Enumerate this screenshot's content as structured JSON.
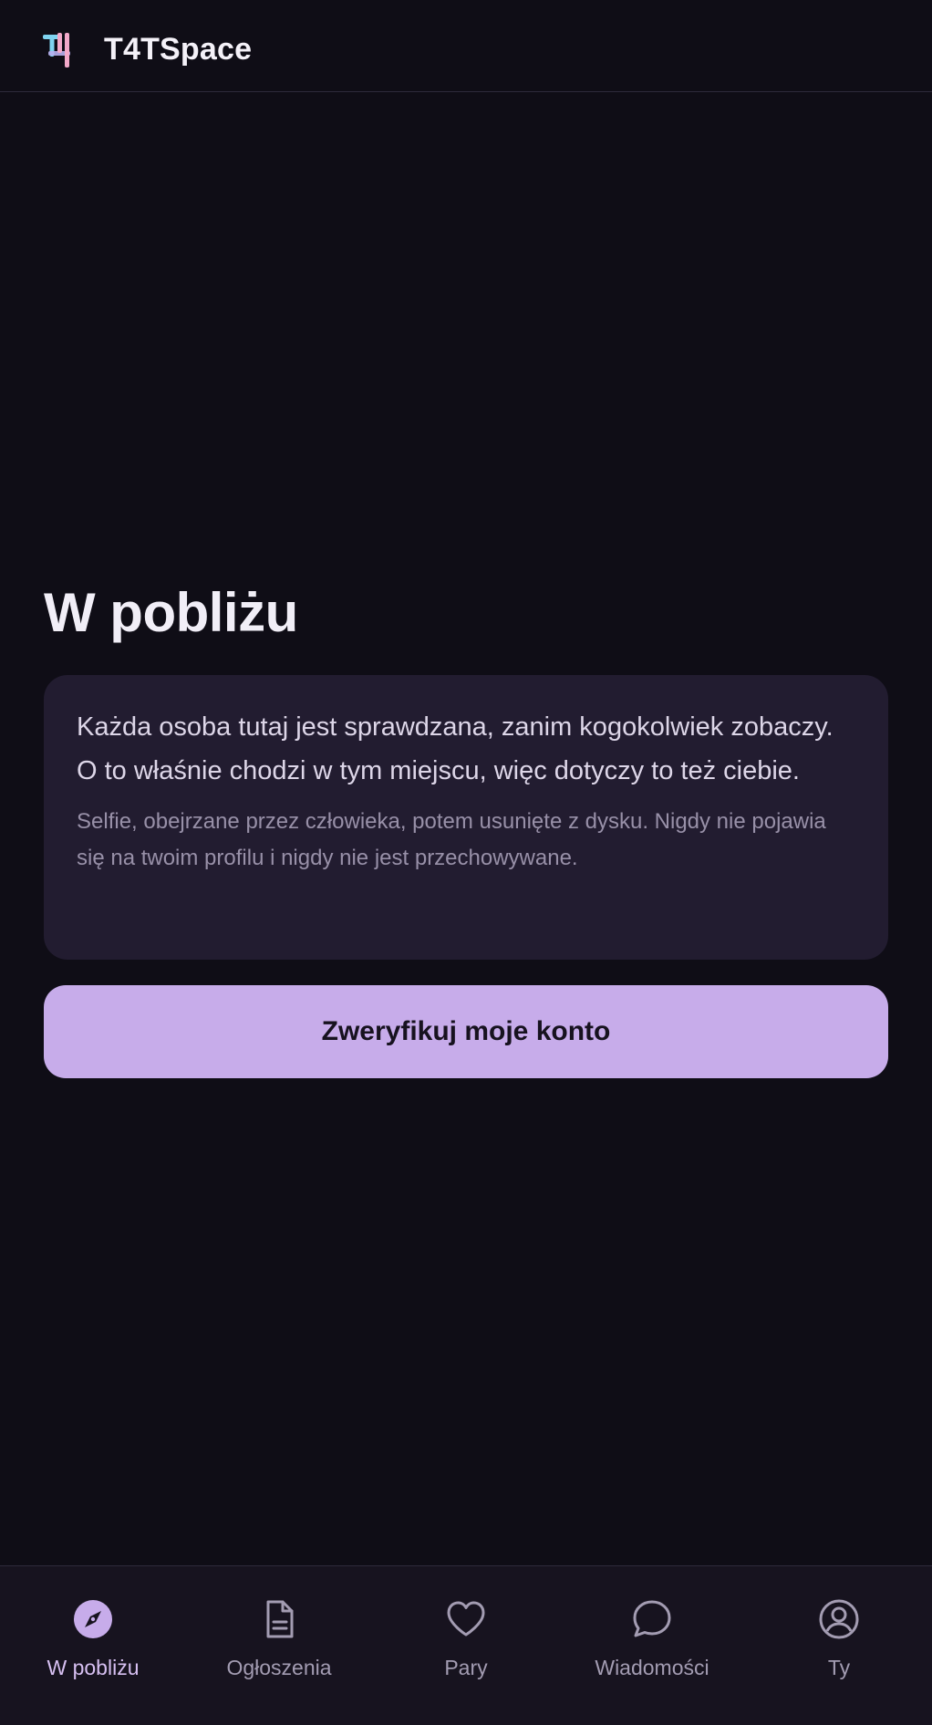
{
  "app": {
    "brand": "T4TSpace",
    "logo_icon": "t4-logo-icon"
  },
  "main": {
    "title": "W pobliżu",
    "card": {
      "text": "Każda osoba tutaj jest sprawdzana, zanim kogokolwiek zobaczy. O to właśnie chodzi w tym miejscu, więc dotyczy to też ciebie.",
      "note": "Selfie, obejrzane przez człowieka, potem usunięte z dysku. Nigdy nie pojawia się na twoim profilu i nigdy nie jest przechowywane."
    },
    "verify_label": "Zweryfikuj moje konto"
  },
  "nav": {
    "items": [
      {
        "label": "W pobliżu",
        "icon": "compass-icon",
        "active": true
      },
      {
        "label": "Ogłoszenia",
        "icon": "document-icon",
        "active": false
      },
      {
        "label": "Pary",
        "icon": "heart-icon",
        "active": false
      },
      {
        "label": "Wiadomości",
        "icon": "chat-bubble-icon",
        "active": false
      },
      {
        "label": "Ty",
        "icon": "user-circle-icon",
        "active": false
      }
    ]
  },
  "colors": {
    "background": "#0f0d16",
    "card": "#221c30",
    "accent": "#c7acea",
    "logo_cyan": "#7fd3f0",
    "logo_pink": "#f3a8c9"
  }
}
